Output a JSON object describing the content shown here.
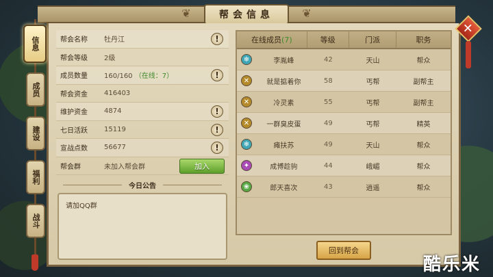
{
  "title": "帮会信息",
  "tabs": [
    {
      "label": "信息",
      "active": true
    },
    {
      "label": "成员",
      "active": false
    },
    {
      "label": "建设",
      "active": false
    },
    {
      "label": "福利",
      "active": false
    },
    {
      "label": "战斗",
      "active": false
    }
  ],
  "info": {
    "name": {
      "label": "帮会名称",
      "value": "牡丹江"
    },
    "level": {
      "label": "帮会等级",
      "value": "2级"
    },
    "members": {
      "label": "成员数量",
      "value": "160/160",
      "online": "（在线：7）"
    },
    "funds": {
      "label": "帮会资金",
      "value": "416403"
    },
    "upkeep": {
      "label": "维护资金",
      "value": "4874"
    },
    "activity": {
      "label": "七日活跃",
      "value": "15119"
    },
    "battle_points": {
      "label": "宣战点数",
      "value": "56677"
    },
    "group": {
      "label": "帮会群",
      "value": "未加入帮会群",
      "join_label": "加入"
    },
    "warn_symbol": "!"
  },
  "notice": {
    "title": "今日公告",
    "text": "请加QQ群"
  },
  "table": {
    "headers": {
      "online": "在线成员",
      "count": "(7)",
      "level": "等级",
      "sect": "门派",
      "role": "职务"
    },
    "rows": [
      {
        "name": "李胤峰",
        "level": "42",
        "sect": "天山",
        "role": "帮众",
        "icon": "tianshan-icon",
        "color": "#3fa6b5"
      },
      {
        "name": "就是掂着你",
        "level": "58",
        "sect": "丐帮",
        "role": "副帮主",
        "icon": "gaibang-icon",
        "color": "#b58a2a"
      },
      {
        "name": "冷灵素",
        "level": "55",
        "sect": "丐帮",
        "role": "副帮主",
        "icon": "gaibang-icon",
        "color": "#b58a2a"
      },
      {
        "name": "一群臭皮蛋",
        "level": "49",
        "sect": "丐帮",
        "role": "精英",
        "icon": "gaibang-icon",
        "color": "#b58a2a"
      },
      {
        "name": "瘫扶苏",
        "level": "49",
        "sect": "天山",
        "role": "帮众",
        "icon": "tianshan-icon",
        "color": "#3fa6b5"
      },
      {
        "name": "成博趁驹",
        "level": "44",
        "sect": "峨嵋",
        "role": "帮众",
        "icon": "emei-icon",
        "color": "#a84bb5"
      },
      {
        "name": "郎天喜次",
        "level": "43",
        "sect": "逍遥",
        "role": "帮众",
        "icon": "xiaoyao-icon",
        "color": "#5aa845"
      }
    ]
  },
  "back_label": "回到帮会",
  "close_symbol": "✕",
  "watermark": "酷乐米"
}
